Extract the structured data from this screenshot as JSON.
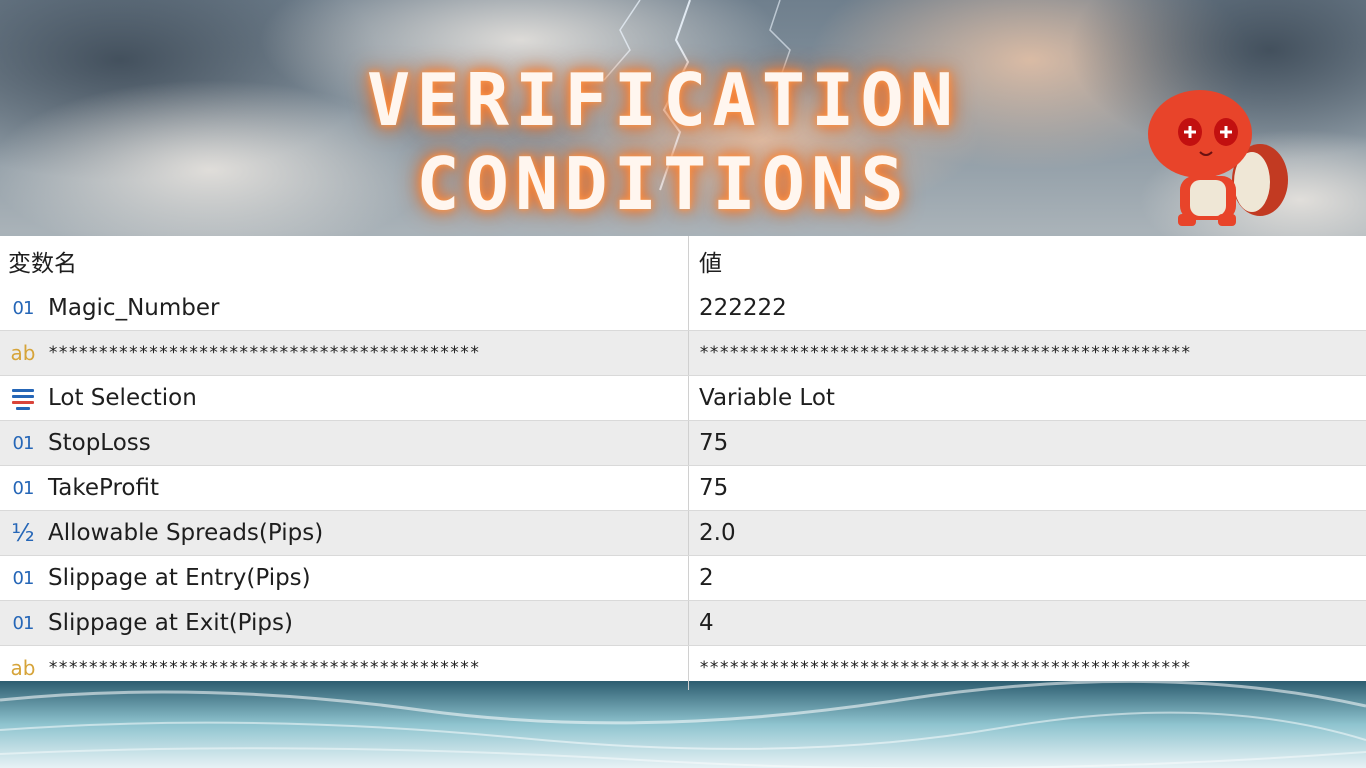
{
  "banner": {
    "title_line1": "VERIFICATION",
    "title_line2": "CONDITIONS"
  },
  "table": {
    "header": {
      "name": "変数名",
      "value": "値"
    },
    "rows": [
      {
        "icon": "int-type-icon",
        "icon_text": "01",
        "name": "Magic_Number",
        "value": "222222"
      },
      {
        "icon": "string-type-icon",
        "icon_text": "ab",
        "name": "*******************************************",
        "value": "*************************************************"
      },
      {
        "icon": "enum-type-icon",
        "icon_text": "",
        "name": "Lot Selection",
        "value": "Variable Lot"
      },
      {
        "icon": "int-type-icon",
        "icon_text": "01",
        "name": "StopLoss",
        "value": "75"
      },
      {
        "icon": "int-type-icon",
        "icon_text": "01",
        "name": "TakeProfit",
        "value": "75"
      },
      {
        "icon": "double-type-icon",
        "icon_text": "½",
        "name": "Allowable Spreads(Pips)",
        "value": "2.0"
      },
      {
        "icon": "int-type-icon",
        "icon_text": "01",
        "name": "Slippage at Entry(Pips)",
        "value": "2"
      },
      {
        "icon": "int-type-icon",
        "icon_text": "01",
        "name": "Slippage at Exit(Pips)",
        "value": "4"
      },
      {
        "icon": "string-type-icon",
        "icon_text": "ab",
        "name": "*******************************************",
        "value": "*************************************************"
      }
    ]
  },
  "colors": {
    "title_glow": "#ff7a2a",
    "int_icon": "#2566b7",
    "string_icon": "#d6a43a",
    "row_alt": "#ececec",
    "mascot_body": "#e8442a"
  }
}
